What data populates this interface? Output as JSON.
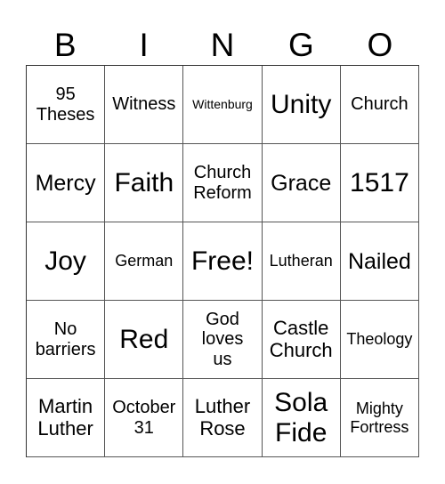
{
  "header": {
    "letters": [
      "B",
      "I",
      "N",
      "G",
      "O"
    ]
  },
  "grid": {
    "rows": [
      [
        "95\nTheses",
        "Witness",
        "Wittenburg",
        "Unity",
        "Church"
      ],
      [
        "Mercy",
        "Faith",
        "Church\nReform",
        "Grace",
        "1517"
      ],
      [
        "Joy",
        "German",
        "Free!",
        "Lutheran",
        "Nailed"
      ],
      [
        "No\nbarriers",
        "Red",
        "God\nloves\nus",
        "Castle\nChurch",
        "Theology"
      ],
      [
        "Martin\nLuther",
        "October\n31",
        "Luther\nRose",
        "Sola\nFide",
        "Mighty\nFortress"
      ]
    ]
  }
}
